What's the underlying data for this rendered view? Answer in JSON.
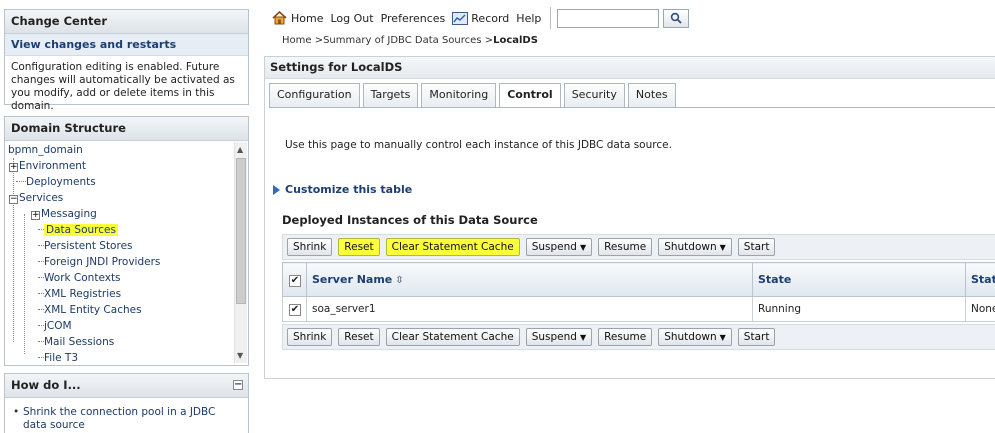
{
  "change_center": {
    "title": "Change Center",
    "link": "View changes and restarts",
    "text": "Configuration editing is enabled. Future changes will automatically be activated as you modify, add or delete items in this domain."
  },
  "domain_structure": {
    "title": "Domain Structure",
    "tree": [
      {
        "label": "bpmn_domain"
      },
      {
        "label": "Environment"
      },
      {
        "label": "Deployments"
      },
      {
        "label": "Services"
      },
      {
        "label": "Messaging"
      },
      {
        "label": "Data Sources"
      },
      {
        "label": "Persistent Stores"
      },
      {
        "label": "Foreign JNDI Providers"
      },
      {
        "label": "Work Contexts"
      },
      {
        "label": "XML Registries"
      },
      {
        "label": "XML Entity Caches"
      },
      {
        "label": "jCOM"
      },
      {
        "label": "Mail Sessions"
      },
      {
        "label": "File T3"
      }
    ]
  },
  "how_do_i": {
    "title": "How do I...",
    "items": [
      "Shrink the connection pool in a JDBC data source"
    ]
  },
  "topnav": {
    "home": "Home",
    "logout": "Log Out",
    "preferences": "Preferences",
    "record": "Record",
    "help": "Help",
    "search_value": ""
  },
  "breadcrumb": {
    "prefix": "Home >Summary of JDBC Data Sources >",
    "current": "LocalDS"
  },
  "settings": {
    "title": "Settings for LocalDS",
    "tabs": [
      "Configuration",
      "Targets",
      "Monitoring",
      "Control",
      "Security",
      "Notes"
    ],
    "active_tab": "Control",
    "intro": "Use this page to manually control each instance of this JDBC data source.",
    "customize": "Customize this table",
    "table_title": "Deployed Instances of this Data Source",
    "buttons": {
      "shrink": "Shrink",
      "reset": "Reset",
      "clear_cache": "Clear Statement Cache",
      "suspend": "Suspend",
      "resume": "Resume",
      "shutdown": "Shutdown",
      "start": "Start"
    },
    "table": {
      "headers": [
        "Server Name",
        "State",
        "Stat"
      ],
      "rows": [
        {
          "server": "soa_server1",
          "state": "Running",
          "stat": "None"
        }
      ]
    }
  },
  "highlight_color": "#fbff3a",
  "accent_color": "#1b3f73"
}
